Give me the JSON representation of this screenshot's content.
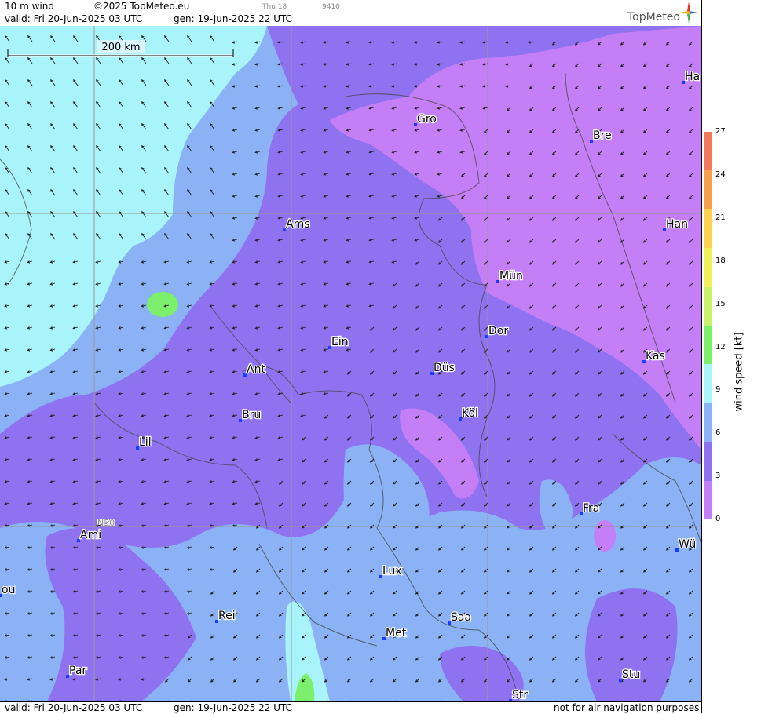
{
  "header": {
    "product": "10 m wind",
    "copyright": "©2025 TopMeteo.eu",
    "nav_day": "Thu 18",
    "nav_code": "9410",
    "valid": "valid:  Fri  20-Jun-2025  03 UTC",
    "gen": "gen: 19-Jun-2025 22 UTC",
    "brand": "TopMeteo"
  },
  "footer": {
    "valid": "valid:  Fri  20-Jun-2025  03 UTC",
    "gen": "gen: 19-Jun-2025 22 UTC",
    "disclaimer": "not for air navigation purposes"
  },
  "map": {
    "scale_label": "200 km",
    "lat_label": "N50",
    "cities": [
      {
        "name": "Gro"
      },
      {
        "name": "Bre"
      },
      {
        "name": "Ha"
      },
      {
        "name": "Ams"
      },
      {
        "name": "Han"
      },
      {
        "name": "Mün"
      },
      {
        "name": "Dor"
      },
      {
        "name": "Ein"
      },
      {
        "name": "Kas"
      },
      {
        "name": "Ant"
      },
      {
        "name": "Düs"
      },
      {
        "name": "Bru"
      },
      {
        "name": "Köl"
      },
      {
        "name": "Lil"
      },
      {
        "name": "Fra"
      },
      {
        "name": "Ami"
      },
      {
        "name": "Wü"
      },
      {
        "name": "Lux"
      },
      {
        "name": "ou"
      },
      {
        "name": "Rei"
      },
      {
        "name": "Saa"
      },
      {
        "name": "Met"
      },
      {
        "name": "Par"
      },
      {
        "name": "Stu"
      },
      {
        "name": "Str"
      }
    ],
    "wind_direction": "northwest-to-southeast (arrows point SW/W)",
    "colors": {
      "calm": "#c47ef6",
      "light": "#8e72f0",
      "moderate": "#8ab2f5",
      "fresh": "#a9f3fb",
      "strong": "#7cf06c"
    }
  },
  "legend": {
    "title": "wind speed  [kt]",
    "ticks": [
      "27",
      "24",
      "21",
      "18",
      "15",
      "12",
      "9",
      "6",
      "3",
      "0"
    ],
    "colors": [
      "#f07a5a",
      "#f6a04e",
      "#fbd24e",
      "#f0f05a",
      "#c8f06a",
      "#7cf06c",
      "#a9f3fb",
      "#8ab2f5",
      "#8e72f0",
      "#c47ef6"
    ]
  }
}
